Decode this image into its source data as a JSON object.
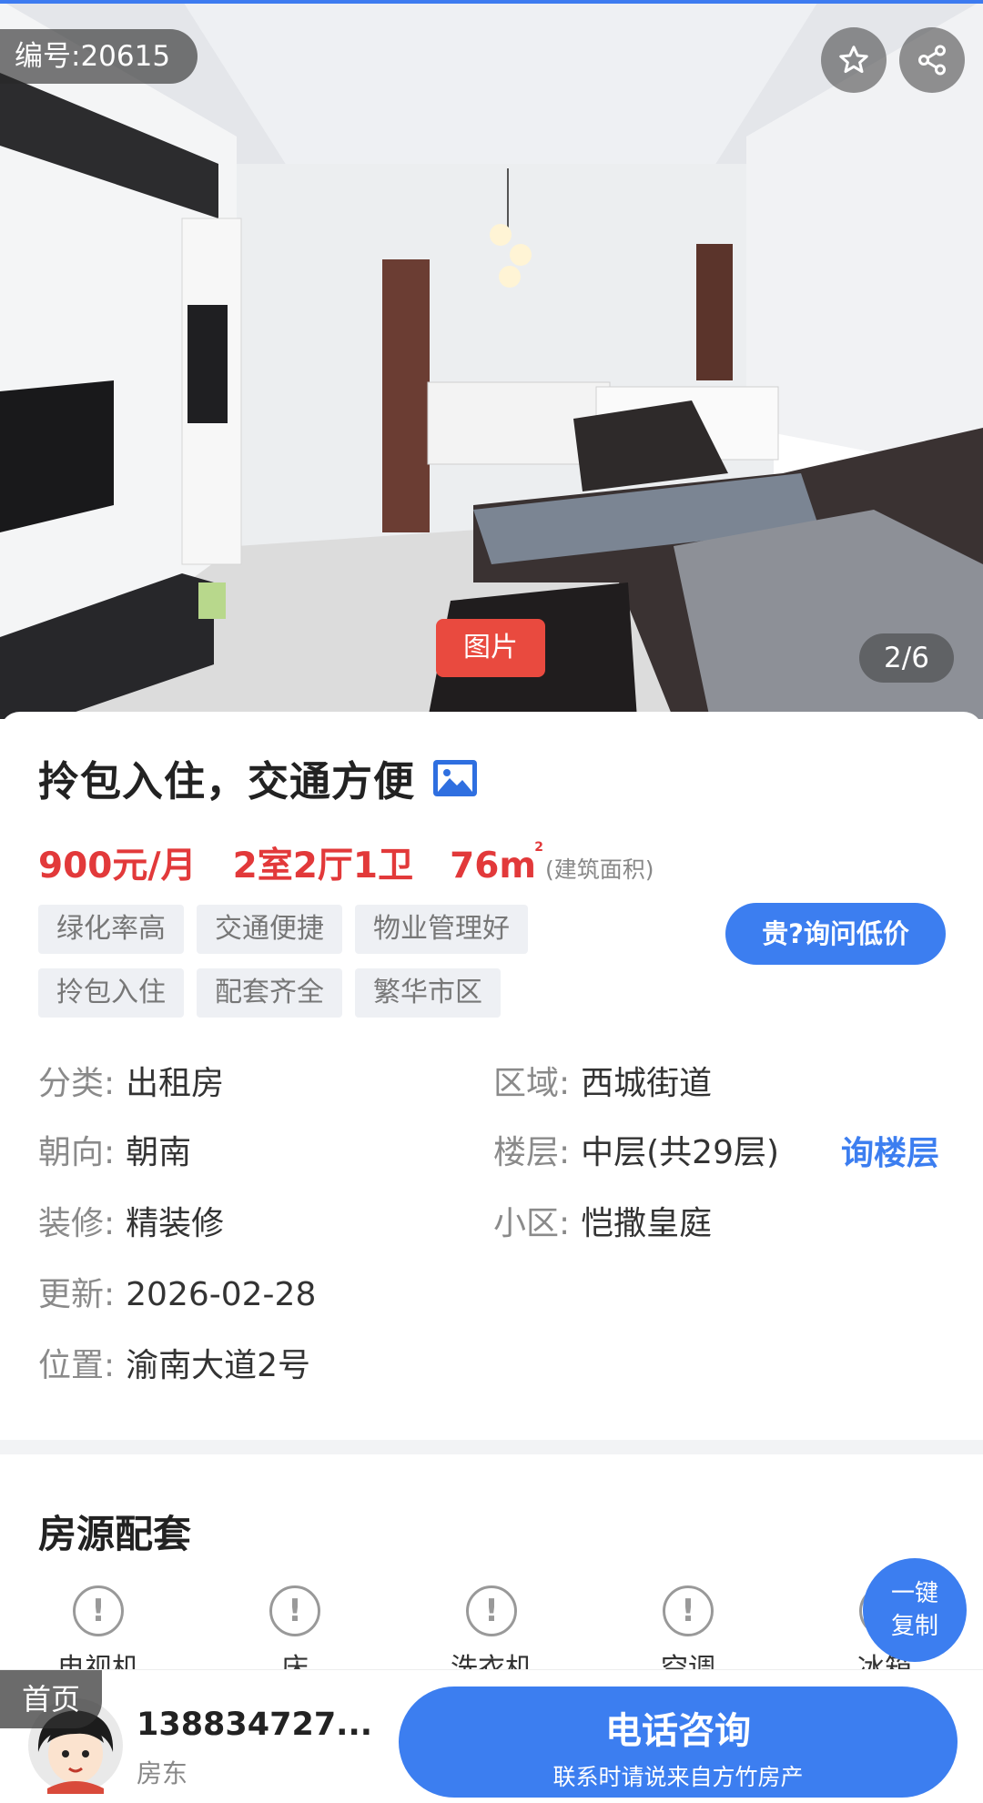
{
  "hero": {
    "listing_id": "编号:20615",
    "photo_tag": "图片",
    "counter": "2/6",
    "star_icon": "star-icon",
    "share_icon": "share-icon"
  },
  "listing": {
    "title": "拎包入住，交通方便",
    "price": "900元/月",
    "layout": "2室2厅1卫",
    "area": "76m",
    "area_unit_sup": "2",
    "area_note": "(建筑面积)",
    "tags": [
      "绿化率高",
      "交通便捷",
      "物业管理好",
      "拎包入住",
      "配套齐全",
      "繁华市区"
    ],
    "cheap_button": "贵?询问低价"
  },
  "info": {
    "category": {
      "key": "分类:",
      "value": "出租房"
    },
    "region": {
      "key": "区域:",
      "value": "西城街道"
    },
    "orientation": {
      "key": "朝向:",
      "value": "朝南"
    },
    "floor": {
      "key": "楼层:",
      "value": "中层(共29层)"
    },
    "ask_floor": "询楼层",
    "decoration": {
      "key": "装修:",
      "value": "精装修"
    },
    "community": {
      "key": "小区:",
      "value": "恺撒皇庭"
    },
    "updated": {
      "key": "更新:",
      "value": "2026-02-28"
    },
    "location": {
      "key": "位置:",
      "value": "渝南大道2号"
    }
  },
  "amenities": {
    "title": "房源配套",
    "items": [
      "电视机",
      "床",
      "洗衣机",
      "空调",
      "冰箱"
    ],
    "icon": "info-circle-icon"
  },
  "copy_button": {
    "line1": "一键",
    "line2": "复制"
  },
  "bottom": {
    "home_tag": "首页",
    "phone": "138834727...",
    "role": "房东",
    "call_main": "电话咨询",
    "call_sub": "联系时请说来自方竹房产"
  },
  "colors": {
    "accent": "#3c7ef0",
    "price": "#e2393a",
    "photo_tag": "#e94a3f"
  }
}
